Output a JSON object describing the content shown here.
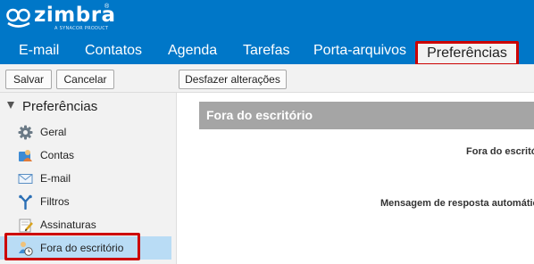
{
  "app": {
    "logo_text": "zimbra",
    "logo_registered": "®",
    "logo_sub": "A SYNACOR PRODUCT"
  },
  "tabs": {
    "items": [
      {
        "label": "E-mail"
      },
      {
        "label": "Contatos"
      },
      {
        "label": "Agenda"
      },
      {
        "label": "Tarefas"
      },
      {
        "label": "Porta-arquivos"
      },
      {
        "label": "Preferências"
      }
    ],
    "active_index": 5
  },
  "toolbar": {
    "save_label": "Salvar",
    "cancel_label": "Cancelar",
    "undo_label": "Desfazer alterações"
  },
  "sidebar": {
    "title": "Preferências",
    "items": [
      {
        "label": "Geral",
        "icon": "gear-icon"
      },
      {
        "label": "Contas",
        "icon": "accounts-icon"
      },
      {
        "label": "E-mail",
        "icon": "envelope-icon"
      },
      {
        "label": "Filtros",
        "icon": "filter-icon"
      },
      {
        "label": "Assinaturas",
        "icon": "signature-icon"
      },
      {
        "label": "Fora do escritório",
        "icon": "out-of-office-icon"
      }
    ],
    "selected_index": 5
  },
  "main": {
    "section_title": "Fora do escritório",
    "fields": [
      {
        "label": "Fora do escritório:"
      },
      {
        "label": "Mensagem de resposta automática:"
      }
    ]
  },
  "colors": {
    "header_bg": "#0077c8",
    "highlight_border": "#cc0000",
    "selected_bg": "#b9dcf5",
    "section_bar": "#a5a5a5"
  }
}
